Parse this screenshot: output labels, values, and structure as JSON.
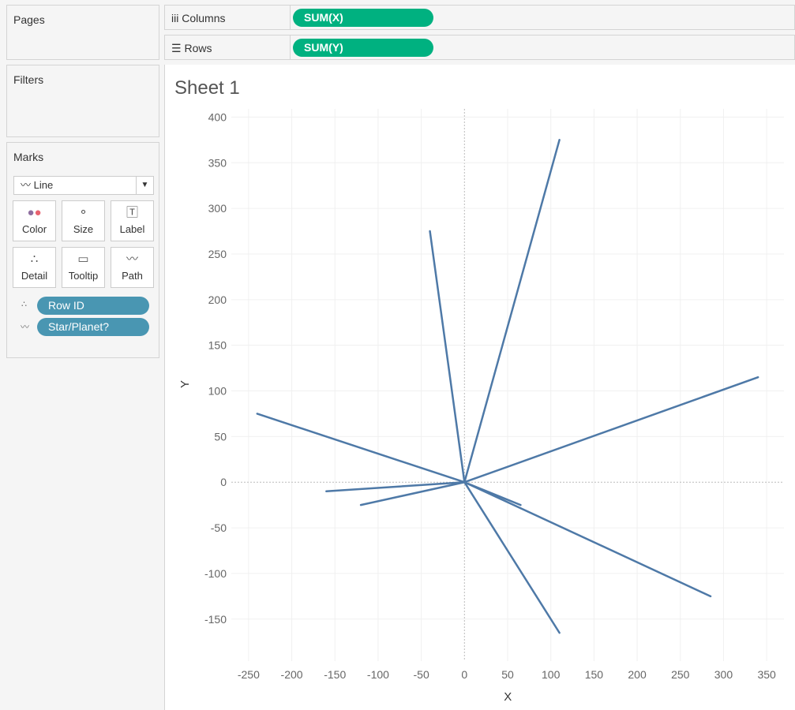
{
  "pages": {
    "title": "Pages"
  },
  "filters": {
    "title": "Filters"
  },
  "marks": {
    "title": "Marks",
    "type": "Line",
    "buttons": [
      {
        "label": "Color",
        "icon": "color-icon"
      },
      {
        "label": "Size",
        "icon": "size-icon"
      },
      {
        "label": "Label",
        "icon": "label-icon"
      },
      {
        "label": "Detail",
        "icon": "detail-icon"
      },
      {
        "label": "Tooltip",
        "icon": "tooltip-icon"
      },
      {
        "label": "Path",
        "icon": "path-icon"
      }
    ],
    "fields": [
      {
        "label": "Row ID",
        "icon": "detail-icon"
      },
      {
        "label": "Star/Planet?",
        "icon": "path-icon"
      }
    ]
  },
  "columns": {
    "label": "Columns",
    "pill": "SUM(X)"
  },
  "rows": {
    "label": "Rows",
    "pill": "SUM(Y)"
  },
  "sheet": {
    "title": "Sheet 1"
  },
  "chart_data": {
    "type": "line",
    "xlabel": "X",
    "ylabel": "Y",
    "xlim": [
      -270,
      370
    ],
    "ylim": [
      -196,
      409
    ],
    "xticks": [
      -250,
      -200,
      -150,
      -100,
      -50,
      0,
      50,
      100,
      150,
      200,
      250,
      300,
      350
    ],
    "yticks": [
      -150,
      -100,
      -50,
      0,
      50,
      100,
      150,
      200,
      250,
      300,
      350,
      400
    ],
    "color": "#4e79a7",
    "series": [
      {
        "name": "path-1",
        "points": [
          [
            0,
            0
          ],
          [
            110,
            375
          ]
        ]
      },
      {
        "name": "path-2",
        "points": [
          [
            0,
            0
          ],
          [
            -40,
            275
          ]
        ]
      },
      {
        "name": "path-3",
        "points": [
          [
            0,
            0
          ],
          [
            340,
            115
          ]
        ]
      },
      {
        "name": "path-4",
        "points": [
          [
            0,
            0
          ],
          [
            -240,
            75
          ]
        ]
      },
      {
        "name": "path-5",
        "points": [
          [
            0,
            0
          ],
          [
            -160,
            -10
          ]
        ]
      },
      {
        "name": "path-6",
        "points": [
          [
            0,
            0
          ],
          [
            -120,
            -25
          ]
        ]
      },
      {
        "name": "path-7",
        "points": [
          [
            0,
            0
          ],
          [
            65,
            -25
          ]
        ]
      },
      {
        "name": "path-8",
        "points": [
          [
            0,
            0
          ],
          [
            285,
            -125
          ]
        ]
      },
      {
        "name": "path-9",
        "points": [
          [
            0,
            0
          ],
          [
            110,
            -165
          ]
        ]
      }
    ]
  }
}
